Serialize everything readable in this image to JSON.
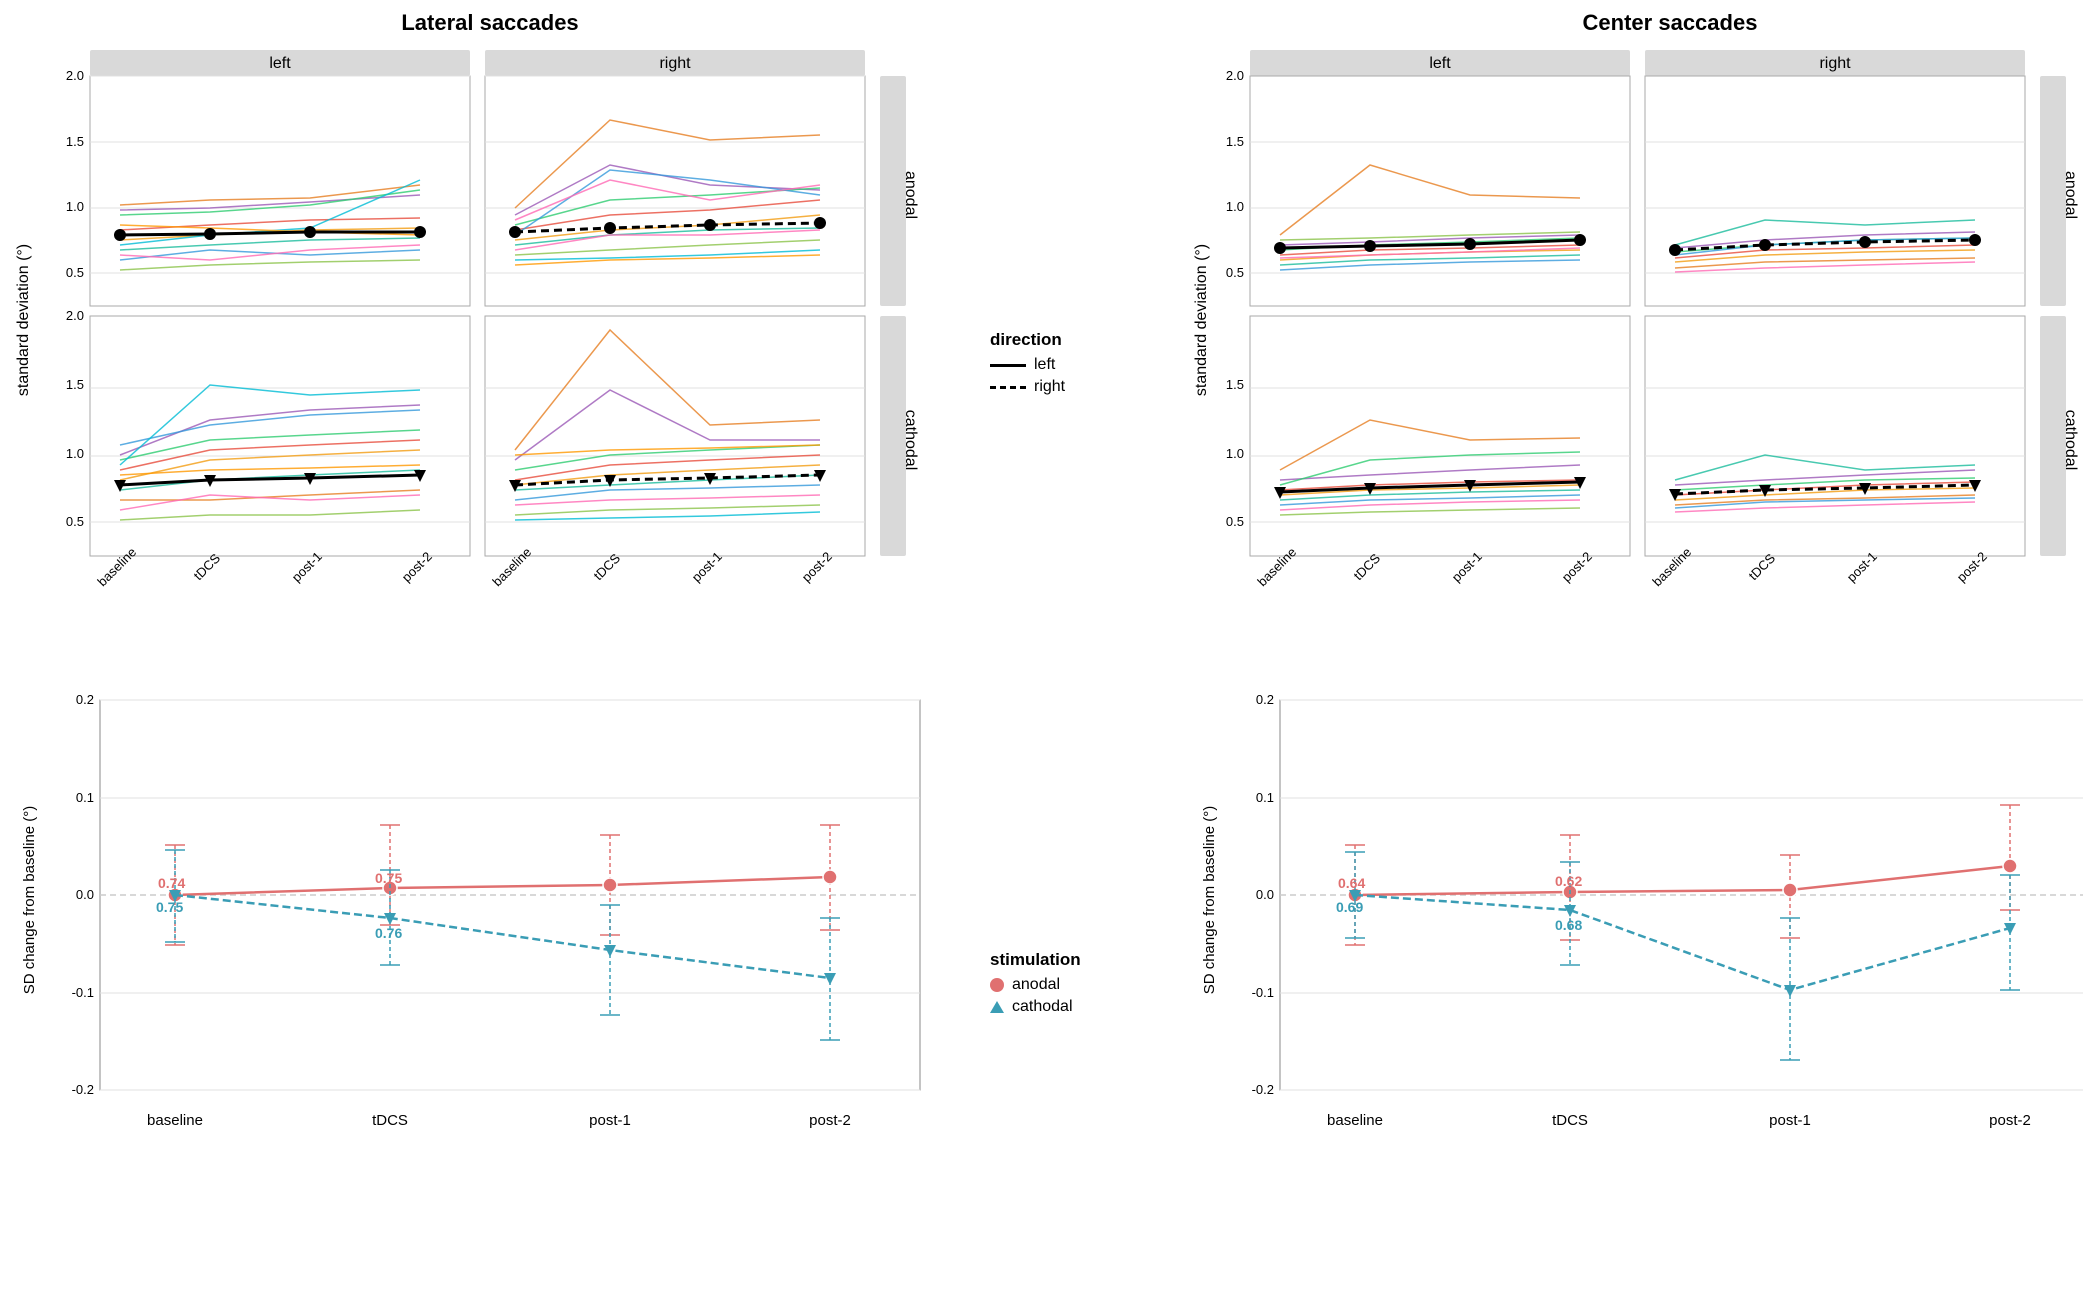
{
  "titles": {
    "lateral": "Lateral saccades",
    "center": "Center saccades"
  },
  "facet_labels": {
    "left": "left",
    "right": "right",
    "anodal": "anodal",
    "cathodal": "cathodal"
  },
  "x_labels": [
    "baseline",
    "tDCS",
    "post-1",
    "post-2"
  ],
  "y_labels_top": [
    "0.5",
    "1.0",
    "1.5",
    "2.0"
  ],
  "y_axis_top": "standard deviation (°)",
  "y_axis_bottom": "SD change from baseline (°)",
  "legend_direction_title": "direction",
  "legend_left": "left",
  "legend_right": "right",
  "legend_stimulation_title": "stimulation",
  "legend_anodal": "anodal",
  "legend_cathodal": "cathodal",
  "bottom_values_lateral": {
    "anodal_baseline": "0.74",
    "anodal_tdcs": "0.75",
    "cathodal_baseline": "0.75",
    "cathodal_tdcs": "0.76"
  },
  "bottom_values_center": {
    "anodal_baseline": "0.64",
    "anodal_tdcs": "0.62",
    "cathodal_baseline": "0.69",
    "cathodal_tdcs": "0.68"
  },
  "colors": {
    "anodal": "#e07070",
    "cathodal": "#3a9db5",
    "anodal_dark": "#c0392b",
    "cathodal_dark": "#2980b9"
  }
}
